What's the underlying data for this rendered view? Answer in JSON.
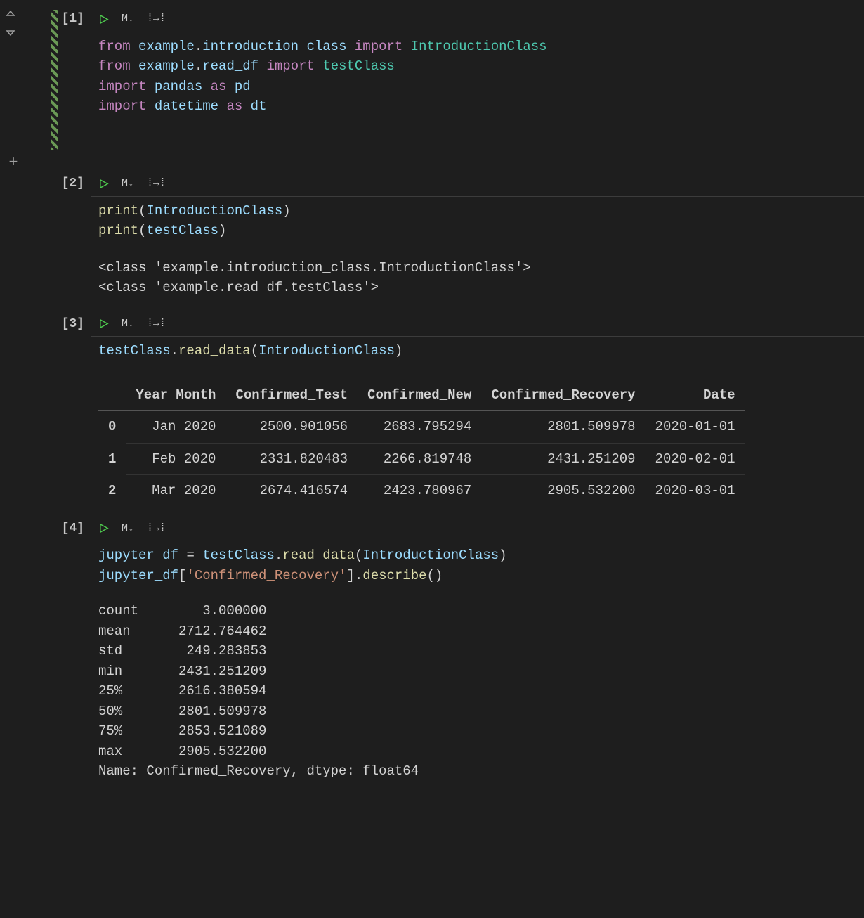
{
  "cells": [
    {
      "exec": "[1]",
      "code_html": "<span class='keyword'>from</span> <span class='module'>example</span><span class='plain'>.</span><span class='module'>introduction_class</span> <span class='keyword'>import</span> <span class='classname'>IntroductionClass</span>\n<span class='keyword'>from</span> <span class='module'>example</span><span class='plain'>.</span><span class='module'>read_df</span> <span class='keyword'>import</span> <span class='classname'>testClass</span>\n<span class='keyword'>import</span> <span class='module'>pandas</span> <span class='keyword'>as</span> <span class='module'>pd</span>\n<span class='keyword'>import</span> <span class='module'>datetime</span> <span class='keyword'>as</span> <span class='module'>dt</span>",
      "output_text": ""
    },
    {
      "exec": "[2]",
      "code_html": "<span class='func'>print</span><span class='plain'>(</span><span class='module'>IntroductionClass</span><span class='plain'>)</span>\n<span class='func'>print</span><span class='plain'>(</span><span class='module'>testClass</span><span class='plain'>)</span>",
      "output_text": "<class 'example.introduction_class.IntroductionClass'>\n<class 'example.read_df.testClass'>"
    },
    {
      "exec": "[3]",
      "code_html": "<span class='module'>testClass</span><span class='plain'>.</span><span class='func'>read_data</span><span class='plain'>(</span><span class='module'>IntroductionClass</span><span class='plain'>)</span>",
      "output_text": ""
    },
    {
      "exec": "[4]",
      "code_html": "<span class='module'>jupyter_df</span> <span class='plain'>=</span> <span class='module'>testClass</span><span class='plain'>.</span><span class='func'>read_data</span><span class='plain'>(</span><span class='module'>IntroductionClass</span><span class='plain'>)</span>\n<span class='module'>jupyter_df</span><span class='plain'>[</span><span class='string'>'Confirmed_Recovery'</span><span class='plain'>].</span><span class='func'>describe</span><span class='plain'>()</span>",
      "output_text": ""
    }
  ],
  "df": {
    "columns": [
      "Year Month",
      "Confirmed_Test",
      "Confirmed_New",
      "Confirmed_Recovery",
      "Date"
    ],
    "index": [
      "0",
      "1",
      "2"
    ],
    "rows": [
      [
        "Jan 2020",
        "2500.901056",
        "2683.795294",
        "2801.509978",
        "2020-01-01"
      ],
      [
        "Feb 2020",
        "2331.820483",
        "2266.819748",
        "2431.251209",
        "2020-02-01"
      ],
      [
        "Mar 2020",
        "2674.416574",
        "2423.780967",
        "2905.532200",
        "2020-03-01"
      ]
    ]
  },
  "describe": {
    "rows": [
      [
        "count",
        "3.000000"
      ],
      [
        "mean",
        "2712.764462"
      ],
      [
        "std",
        "249.283853"
      ],
      [
        "min",
        "2431.251209"
      ],
      [
        "25%",
        "2616.380594"
      ],
      [
        "50%",
        "2801.509978"
      ],
      [
        "75%",
        "2853.521089"
      ],
      [
        "max",
        "2905.532200"
      ]
    ],
    "footer": "Name: Confirmed_Recovery, dtype: float64"
  },
  "toolbar": {
    "markdown_label": "M↓",
    "split_label": "⁞→⁞"
  }
}
